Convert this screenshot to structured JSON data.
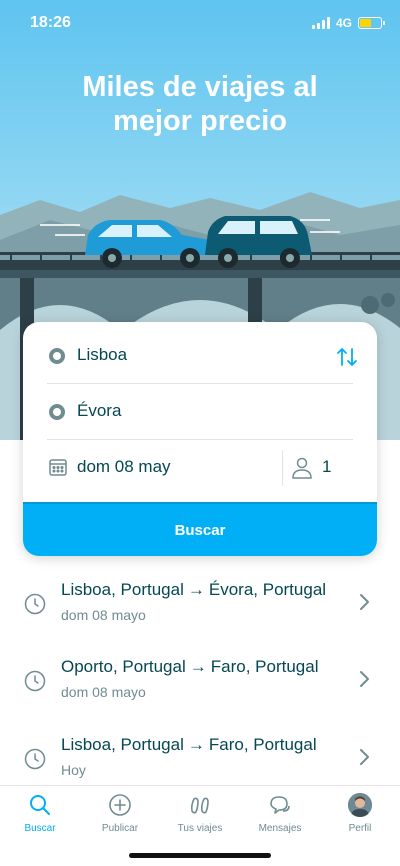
{
  "status": {
    "time": "18:26",
    "network": "4G"
  },
  "hero": {
    "title_line1": "Miles de viajes al",
    "title_line2": "mejor precio"
  },
  "search": {
    "from": "Lisboa",
    "to": "Évora",
    "date": "dom 08 may",
    "passengers": "1",
    "button_label": "Buscar"
  },
  "recent": [
    {
      "from": "Lisboa, Portugal",
      "to": "Évora, Portugal",
      "when": "dom 08 mayo"
    },
    {
      "from": "Oporto, Portugal",
      "to": "Faro, Portugal",
      "when": "dom 08 mayo"
    },
    {
      "from": "Lisboa, Portugal",
      "to": "Faro, Portugal",
      "when": "Hoy"
    }
  ],
  "arrow": "→",
  "tabs": [
    {
      "label": "Buscar",
      "icon": "search-icon",
      "active": true
    },
    {
      "label": "Publicar",
      "icon": "plus-circle-icon"
    },
    {
      "label": "Tus viajes",
      "icon": "trips-icon"
    },
    {
      "label": "Mensajes",
      "icon": "chat-icon"
    },
    {
      "label": "Perfil",
      "icon": "avatar"
    }
  ],
  "colors": {
    "accent": "#00aff5",
    "text": "#054752",
    "muted": "#708c91"
  }
}
